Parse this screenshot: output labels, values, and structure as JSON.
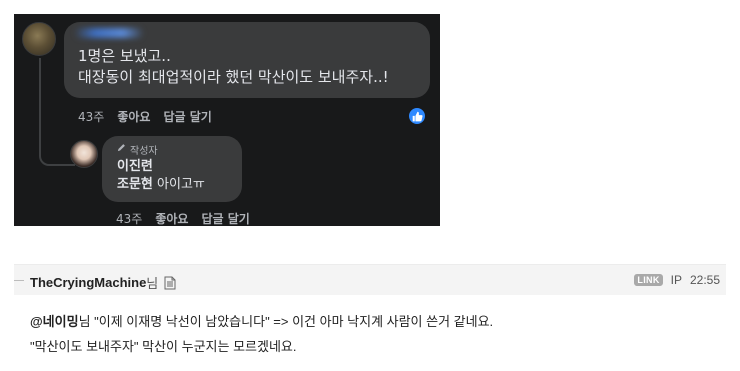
{
  "screenshot": {
    "comment": {
      "line1": "1명은 보냈고..",
      "line2": "대장동이 최대업적이라 했던 막산이도 보내주자..!",
      "actions": {
        "time": "43주",
        "like": "좋아요",
        "reply": "답글 달기"
      },
      "like_icon": "thumbs-up-icon"
    },
    "reply": {
      "author_tag": "작성자",
      "name": "이진련",
      "mention": "조문현",
      "text": " 아이고ㅠ",
      "actions": {
        "time": "43주",
        "like": "좋아요",
        "reply": "답글 달기"
      }
    }
  },
  "comment": {
    "username": "TheCryingMachine",
    "honorific": "님",
    "link_badge": "LINK",
    "ip_label": "IP",
    "time": "22:55",
    "mention": "@네이밍",
    "body_line1_rest": "님 \"이제 이재명 낙선이 남았습니다\" => 이건 아마 낙지계 사람이 쓴거 같네요.",
    "body_line2": "\"막산이도 보내주자\" 막산이 누군지는 모르겠네요."
  },
  "colors": {
    "fb_background": "#18191a",
    "fb_bubble": "#3a3b3c",
    "fb_text": "#e4e6eb",
    "fb_muted": "#b0b3b8",
    "fb_like_blue": "#2e89ff",
    "bar_background": "#f4f4f4"
  }
}
